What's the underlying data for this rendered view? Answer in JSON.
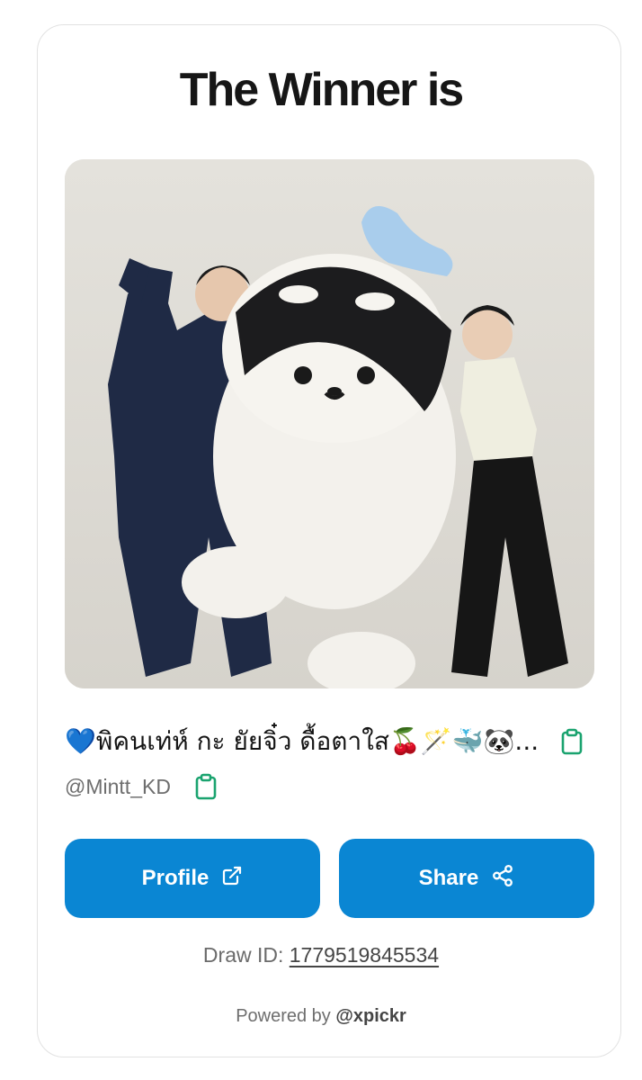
{
  "heading": "The Winner is",
  "winner": {
    "name": "💙พิคนเท่ห์ กะ ยัยจิ๋ว ดื้อตาใส🍒🪄🐳🐼...",
    "handle": "@Mintt_KD"
  },
  "buttons": {
    "profile": "Profile",
    "share": "Share"
  },
  "draw": {
    "label": "Draw ID:",
    "id": "1779519845534"
  },
  "footer": {
    "prefix": "Powered by",
    "brand": "@xpickr"
  },
  "icons": {
    "copy": "clipboard-icon",
    "profile": "external-link-icon",
    "share": "share-nodes-icon"
  },
  "colors": {
    "button": "#0a86d3",
    "copy_icon": "#1aa36f"
  }
}
